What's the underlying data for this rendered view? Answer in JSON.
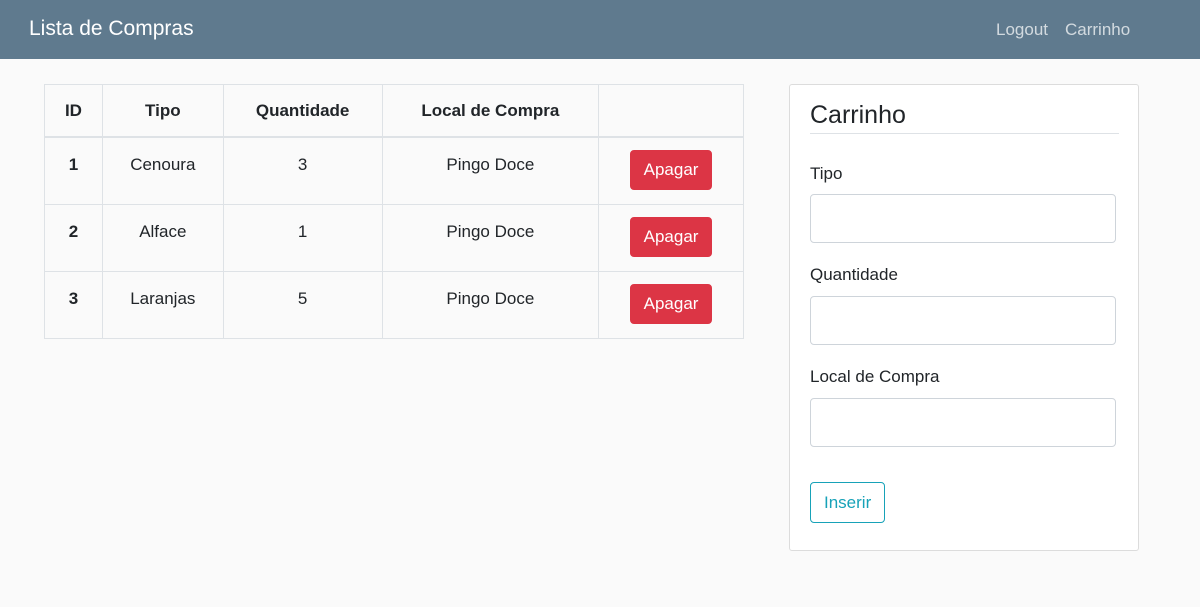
{
  "navbar": {
    "brand": "Lista de Compras",
    "links": [
      "Logout",
      "Carrinho"
    ]
  },
  "table": {
    "headers": [
      "ID",
      "Tipo",
      "Quantidade",
      "Local de Compra",
      ""
    ],
    "rows": [
      {
        "id": "1",
        "tipo": "Cenoura",
        "quantidade": "3",
        "local": "Pingo Doce",
        "action": "Apagar"
      },
      {
        "id": "2",
        "tipo": "Alface",
        "quantidade": "1",
        "local": "Pingo Doce",
        "action": "Apagar"
      },
      {
        "id": "3",
        "tipo": "Laranjas",
        "quantidade": "5",
        "local": "Pingo Doce",
        "action": "Apagar"
      }
    ]
  },
  "form": {
    "title": "Carrinho",
    "fields": [
      {
        "label": "Tipo",
        "value": ""
      },
      {
        "label": "Quantidade",
        "value": ""
      },
      {
        "label": "Local de Compra",
        "value": ""
      }
    ],
    "submit_label": "Inserir"
  },
  "colors": {
    "navbar": "#5f7a8e",
    "danger": "#dc3545",
    "info": "#17a2b8"
  }
}
